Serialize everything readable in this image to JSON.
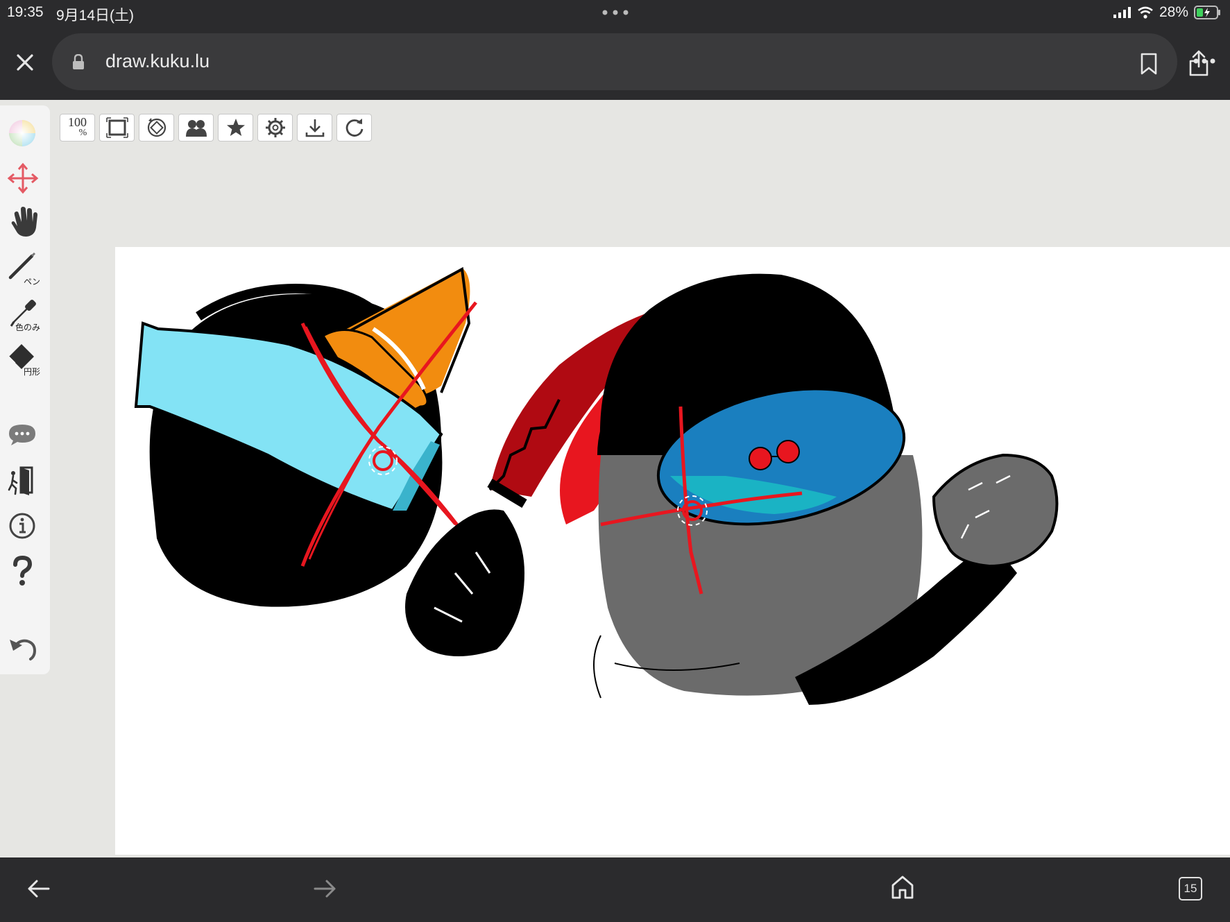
{
  "status_bar": {
    "time": "19:35",
    "date": "9月14日(土)",
    "battery": "28%"
  },
  "browser": {
    "url": "draw.kuku.lu",
    "tab_count": "15"
  },
  "tools": {
    "pen_label": "ペン",
    "color_only_label": "色のみ",
    "shape_label": "円形"
  },
  "toolbar": {
    "zoom_top": "100",
    "zoom_bottom": "%"
  },
  "colors": {
    "chrome": "#2b2b2d",
    "canvas_bg": "#e6e6e3",
    "cyan": "#83e3f5",
    "orange": "#f28c0f",
    "red": "#e8161f",
    "blue_visor": "#1a7fbf",
    "gray_body": "#6b6b6b"
  },
  "icons": [
    "close-icon",
    "lock-icon",
    "bookmark-icon",
    "share-icon",
    "more-icon",
    "color-wheel-icon",
    "move-icon",
    "hand-icon",
    "pen-icon",
    "eyedropper-icon",
    "eraser-icon",
    "chat-icon",
    "exit-icon",
    "info-icon",
    "help-icon",
    "undo-icon",
    "fit-icon",
    "rotate-icon",
    "layers-icon",
    "star-icon",
    "gear-icon",
    "download-icon",
    "refresh-icon",
    "back-icon",
    "forward-icon",
    "home-icon",
    "tabs-icon"
  ]
}
